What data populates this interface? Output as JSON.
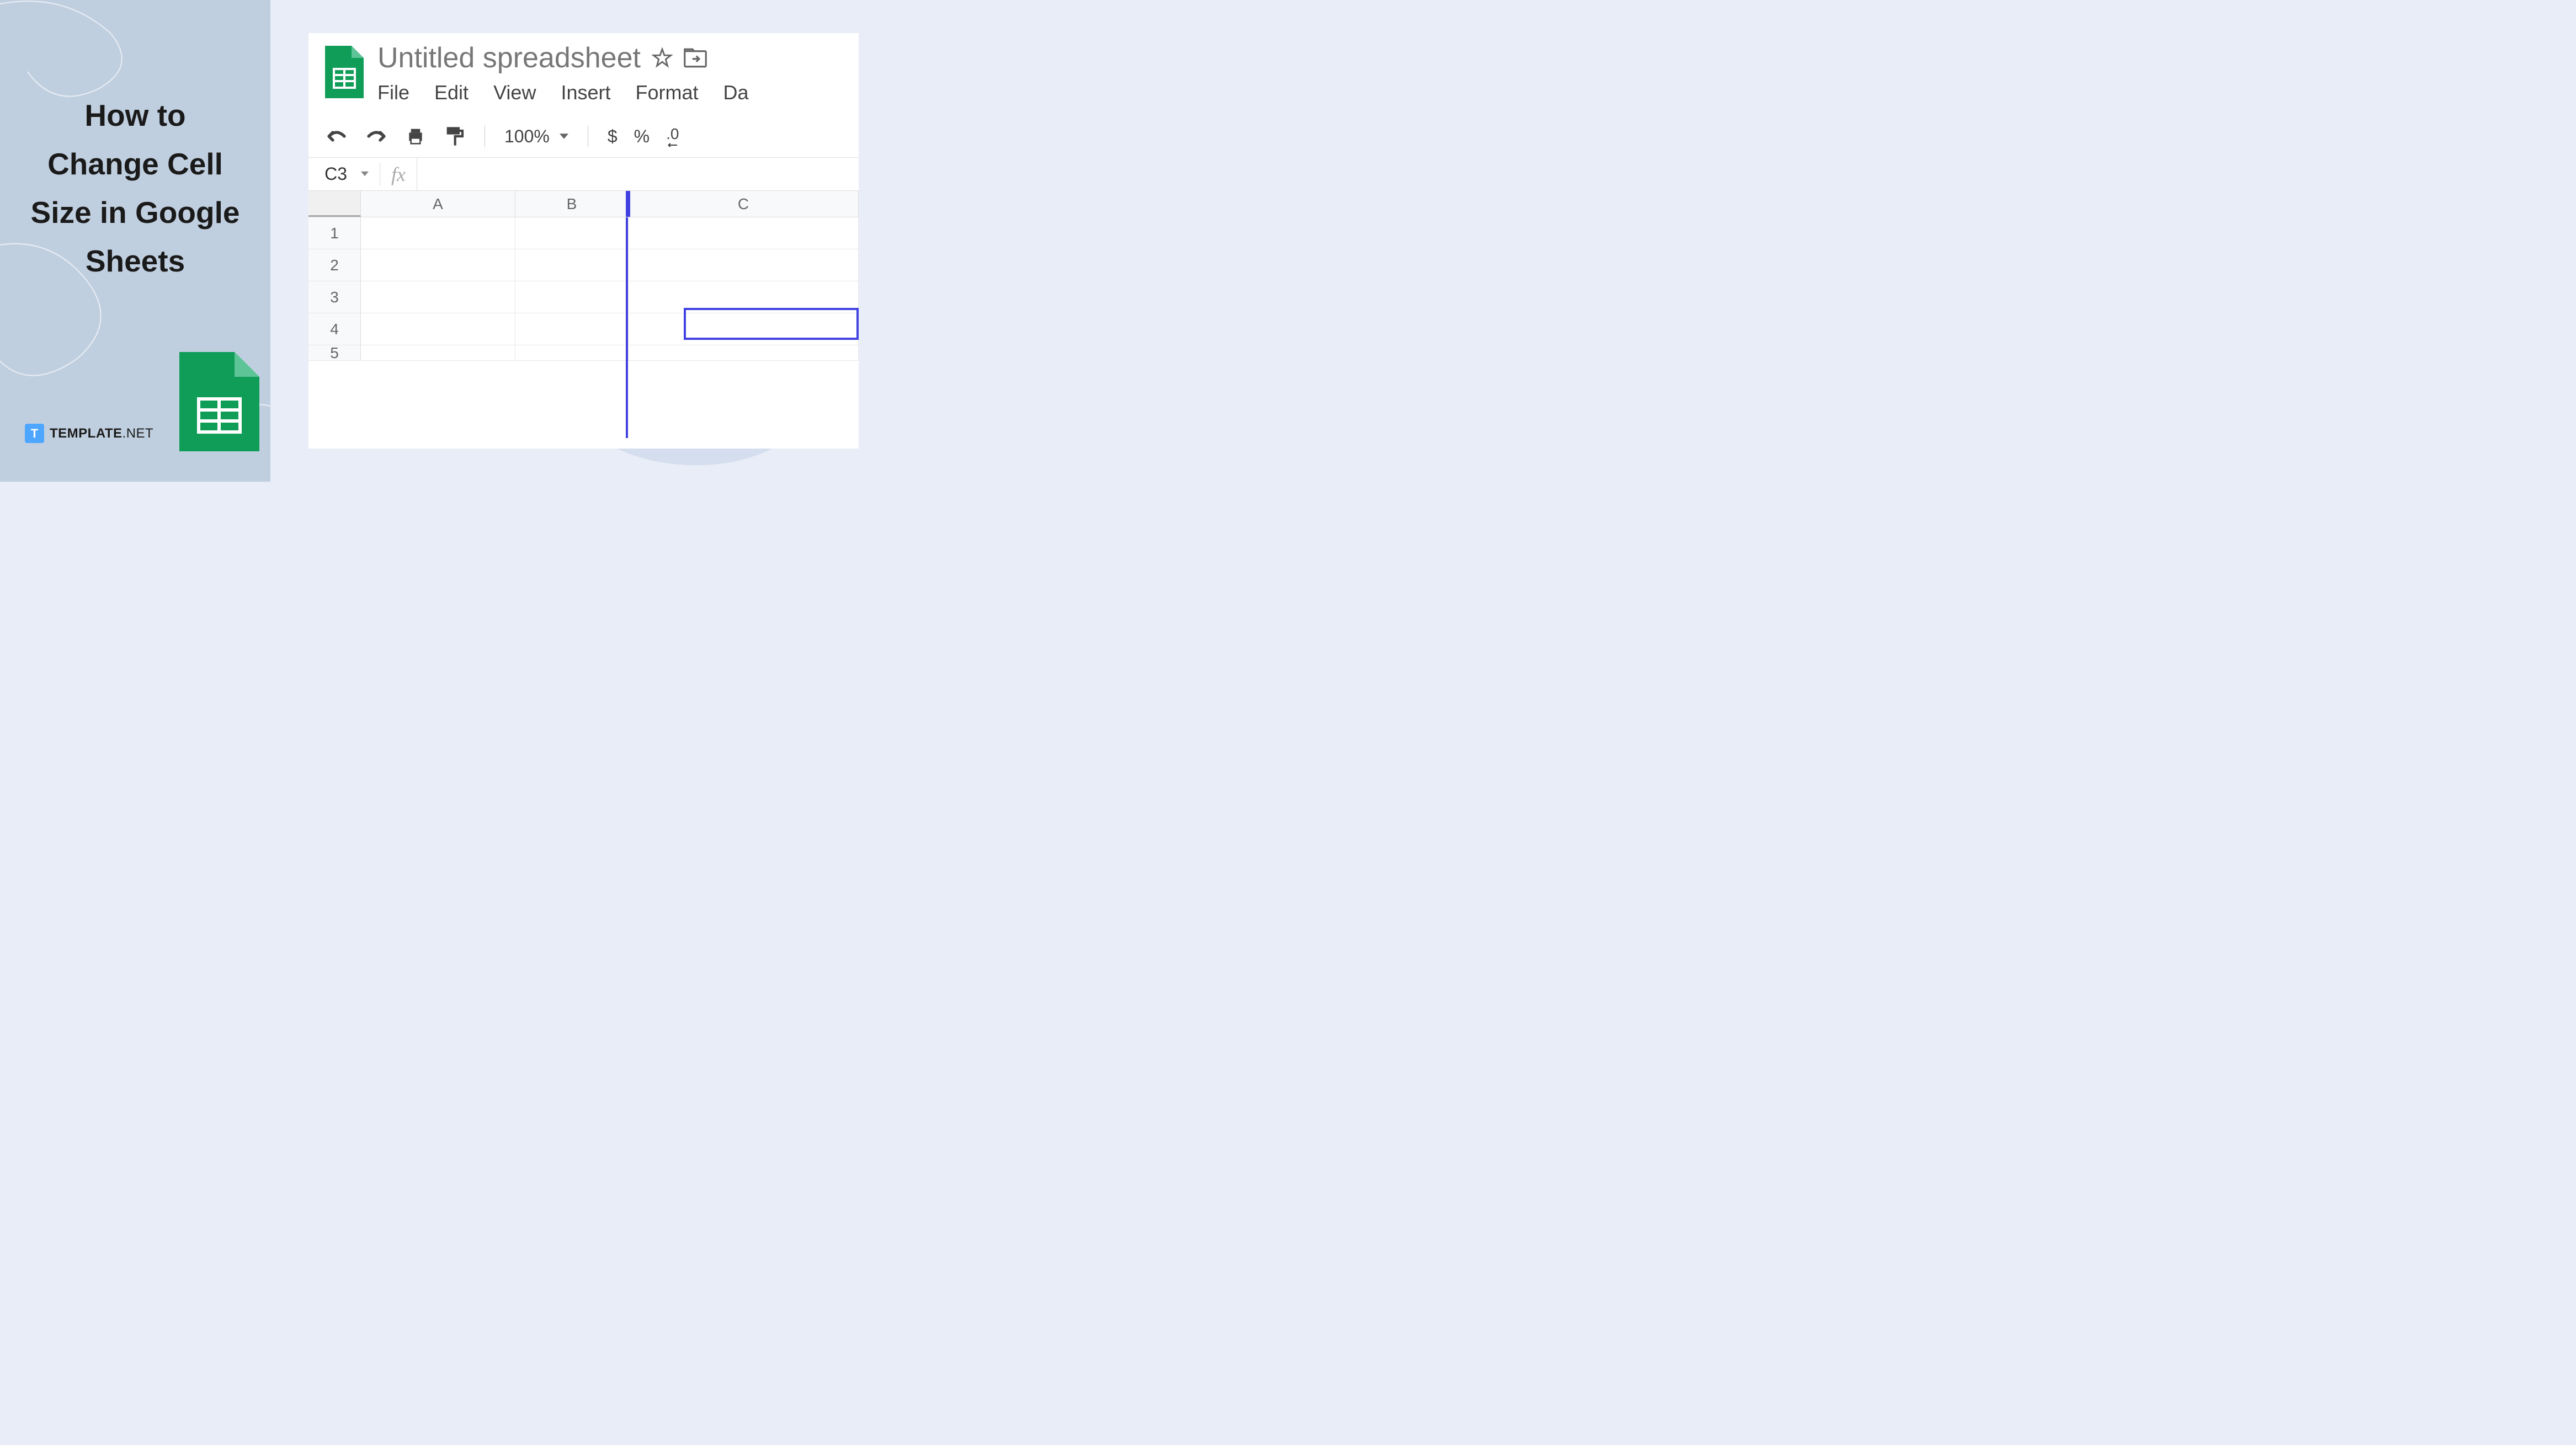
{
  "left_panel": {
    "title": "How to Change Cell Size in Google Sheets",
    "logo_brand": "TEMPLATE",
    "logo_suffix": ".NET"
  },
  "sheets": {
    "doc_title": "Untitled spreadsheet",
    "menu": {
      "file": "File",
      "edit": "Edit",
      "view": "View",
      "insert": "Insert",
      "format": "Format",
      "data": "Da"
    },
    "toolbar": {
      "zoom": "100%",
      "currency": "$",
      "percent": "%",
      "decimal": ".0"
    },
    "name_box": "C3",
    "fx_label": "fx",
    "columns": [
      "A",
      "B",
      "C"
    ],
    "rows": [
      "1",
      "2",
      "3",
      "4",
      "5"
    ]
  }
}
